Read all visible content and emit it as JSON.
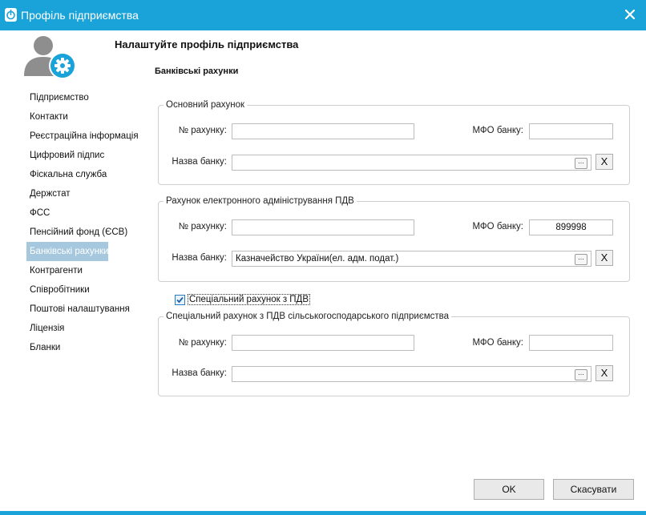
{
  "window": {
    "title": "Профіль підприємства"
  },
  "header": {
    "title": "Налаштуйте профіль підприємства",
    "section": "Банківські рахунки"
  },
  "sidebar": {
    "items": [
      {
        "label": "Підприємство"
      },
      {
        "label": "Контакти"
      },
      {
        "label": "Реєстраційна інформація"
      },
      {
        "label": "Цифровий підпис"
      },
      {
        "label": "Фіскальна служба"
      },
      {
        "label": "Держстат"
      },
      {
        "label": "ФСС"
      },
      {
        "label": "Пенсійний фонд (ЄСВ)"
      },
      {
        "label": "Банківські рахунки"
      },
      {
        "label": "Контрагенти"
      },
      {
        "label": "Співробітники"
      },
      {
        "label": "Поштові налаштування"
      },
      {
        "label": "Ліцензія"
      },
      {
        "label": "Бланки"
      }
    ],
    "active_index": 8
  },
  "main_account": {
    "legend": "Основний рахунок",
    "account_label": "№ рахунку:",
    "account_value": "",
    "mfo_label": "МФО банку:",
    "mfo_value": "",
    "bank_label": "Назва банку:",
    "bank_value": "",
    "browse_label": "...",
    "clear_label": "X"
  },
  "vat_account": {
    "legend": "Рахунок електронного адміністрування ПДВ",
    "account_label": "№ рахунку:",
    "account_value": "",
    "mfo_label": "МФО банку:",
    "mfo_value": "899998",
    "bank_label": "Назва банку:",
    "bank_value": "Казначейство України(ел. адм. подат.)",
    "browse_label": "...",
    "clear_label": "X"
  },
  "special_checkbox": {
    "label": "Спеціальний рахунок з ПДВ",
    "checked": true
  },
  "agri_account": {
    "legend": "Спеціальний рахунок з ПДВ сільськогосподарського підприємства",
    "account_label": "№ рахунку:",
    "account_value": "",
    "mfo_label": "МФО банку:",
    "mfo_value": "",
    "bank_label": "Назва банку:",
    "bank_value": "",
    "browse_label": "...",
    "clear_label": "X"
  },
  "footer": {
    "ok_label": "OK",
    "cancel_label": "Скасувати"
  },
  "colors": {
    "titlebar": "#1aa3d9",
    "active_nav": "#a5c8de",
    "gear_badge": "#1aa3d9"
  }
}
